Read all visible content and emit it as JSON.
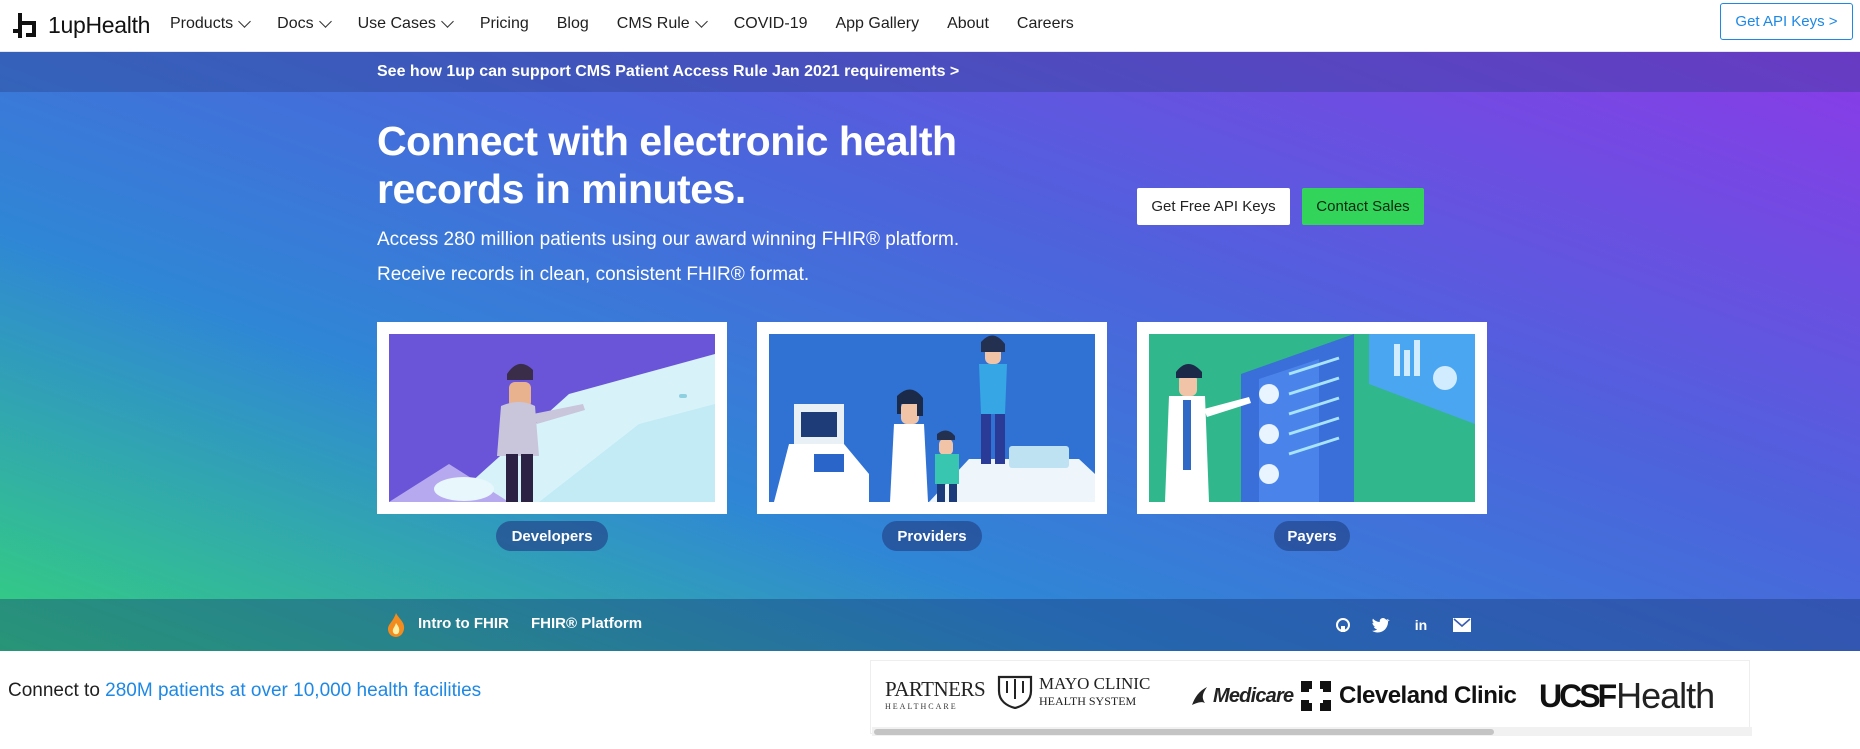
{
  "nav": {
    "logo_text": "1upHealth",
    "items": [
      {
        "label": "Products",
        "dropdown": true
      },
      {
        "label": "Docs",
        "dropdown": true
      },
      {
        "label": "Use Cases",
        "dropdown": true
      },
      {
        "label": "Pricing",
        "dropdown": false
      },
      {
        "label": "Blog",
        "dropdown": false
      },
      {
        "label": "CMS Rule",
        "dropdown": true
      },
      {
        "label": "COVID-19",
        "dropdown": false
      },
      {
        "label": "App Gallery",
        "dropdown": false
      },
      {
        "label": "About",
        "dropdown": false
      },
      {
        "label": "Careers",
        "dropdown": false
      }
    ],
    "cta_label": "Get API Keys  >"
  },
  "announcement": "See how 1up can support CMS Patient Access Rule Jan 2021 requirements  >",
  "hero": {
    "title": "Connect with electronic health records in minutes.",
    "subtitle_line1": "Access 280 million patients using our award winning FHIR® platform.",
    "subtitle_line2": "Receive records in clean, consistent FHIR® format.",
    "btn_api": "Get Free API Keys",
    "btn_sales": "Contact Sales"
  },
  "cards": [
    {
      "label": "Developers"
    },
    {
      "label": "Providers"
    },
    {
      "label": "Payers"
    }
  ],
  "subbar": {
    "intro": "Intro to FHIR",
    "platform": "FHIR® Platform",
    "social": [
      "github-icon",
      "twitter-icon",
      "linkedin-icon",
      "email-icon"
    ]
  },
  "bottom": {
    "prefix": "Connect to ",
    "highlight": "280M patients at over 10,000 health facilities"
  },
  "partners": [
    {
      "name": "PARTNERS",
      "sub": "HEALTHCARE"
    },
    {
      "name": "MAYO CLINIC",
      "sub": "HEALTH SYSTEM"
    },
    {
      "name": "Medicare"
    },
    {
      "name": "Cleveland Clinic"
    },
    {
      "name": "UCSF",
      "sub": "Health"
    }
  ],
  "colors": {
    "accent": "#1e88e5",
    "green_button": "#33d45a",
    "gradient_start": "#34d27c",
    "gradient_end": "#8b3ae7"
  }
}
